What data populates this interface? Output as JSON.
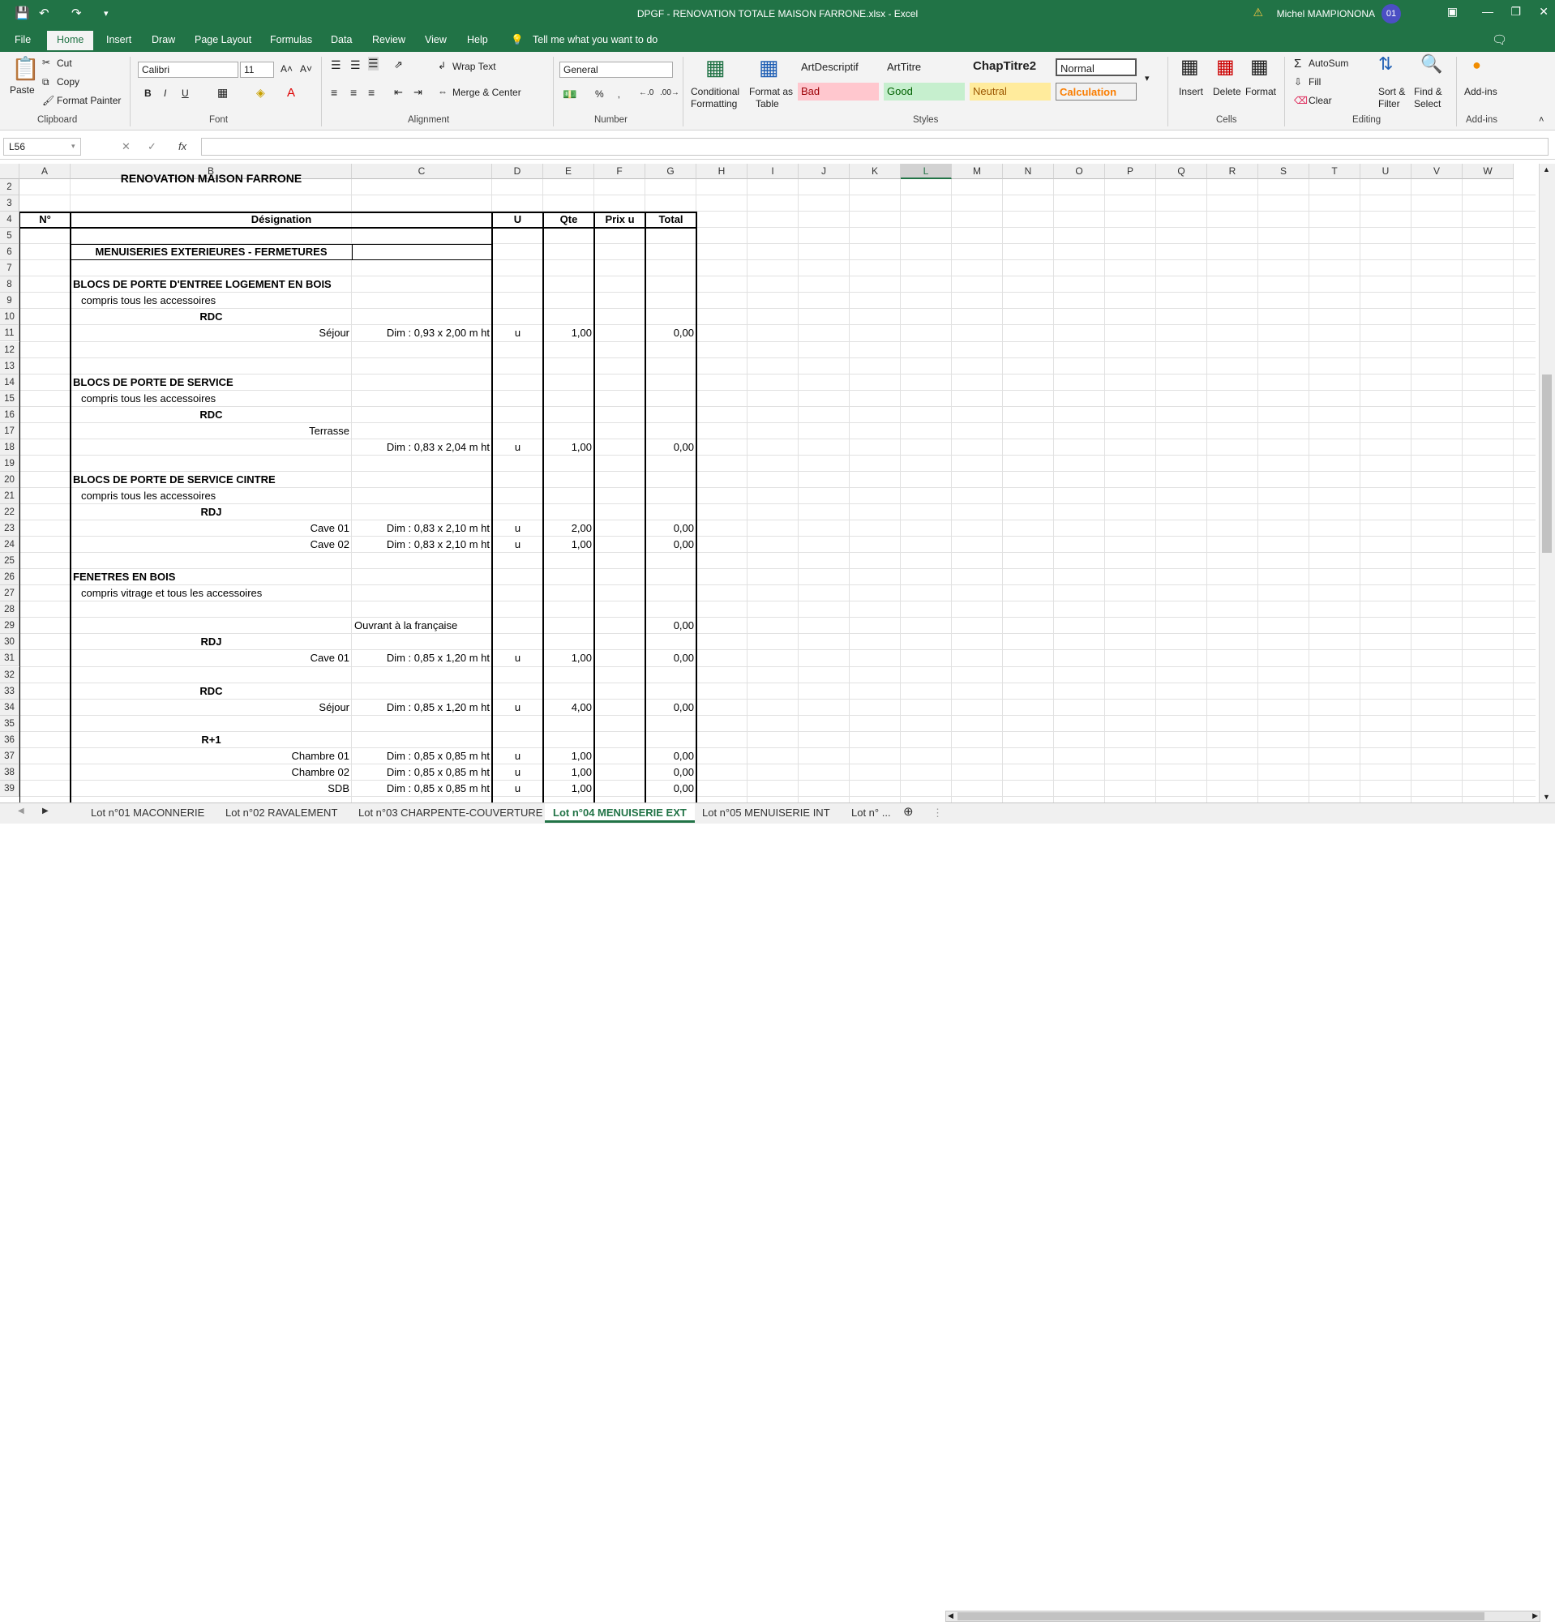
{
  "window": {
    "title": "DPGF - RENOVATION TOTALE MAISON FARRONE.xlsx  -  Excel",
    "user_name": "Michel MAMPIONONA",
    "user_initials": "01"
  },
  "menu_tabs": [
    "File",
    "Home",
    "Insert",
    "Draw",
    "Page Layout",
    "Formulas",
    "Data",
    "Review",
    "View",
    "Help"
  ],
  "tell_me": "Tell me what you want to do",
  "ribbon": {
    "clipboard": {
      "paste": "Paste",
      "cut": "Cut",
      "copy": "Copy",
      "format_painter": "Format Painter",
      "label": "Clipboard"
    },
    "font": {
      "name": "Calibri",
      "size": "11",
      "label": "Font",
      "bold": "B",
      "italic": "I",
      "underline": "U"
    },
    "alignment": {
      "wrap_text": "Wrap Text",
      "merge_center": "Merge & Center",
      "label": "Alignment"
    },
    "number": {
      "format": "General",
      "percent": "%",
      "label": "Number"
    },
    "styles": {
      "conditional": [
        "Conditional",
        "Formatting"
      ],
      "format_table": [
        "Format as",
        "Table"
      ],
      "cells": [
        "ArtDescriptif",
        "ArtTitre",
        "ChapTitre2",
        "Normal",
        "Bad",
        "Good",
        "Neutral",
        "Calculation"
      ],
      "label": "Styles"
    },
    "cells": {
      "insert": "Insert",
      "delete": "Delete",
      "format": "Format",
      "label": "Cells"
    },
    "editing": {
      "autosum": "AutoSum",
      "fill": "Fill",
      "clear": "Clear",
      "sort": [
        "Sort &",
        "Filter"
      ],
      "find": [
        "Find &",
        "Select"
      ],
      "label": "Editing"
    },
    "addins": {
      "button": "Add-ins",
      "label": "Add-ins"
    }
  },
  "formula_bar": {
    "name_box": "L56",
    "fx": "fx",
    "content": ""
  },
  "columns": [
    "A",
    "B",
    "C",
    "D",
    "E",
    "F",
    "G",
    "H",
    "I",
    "J",
    "K",
    "L",
    "M",
    "N",
    "O",
    "P",
    "Q",
    "R",
    "S",
    "T",
    "U",
    "V",
    "W"
  ],
  "rows": [
    "2",
    "3",
    "4",
    "5",
    "6",
    "7",
    "8",
    "9",
    "10",
    "11",
    "12",
    "13",
    "14",
    "15",
    "16",
    "17",
    "18",
    "19",
    "20",
    "21",
    "22",
    "23",
    "24",
    "25",
    "26",
    "27",
    "28",
    "29",
    "30",
    "31",
    "32",
    "33",
    "34",
    "35",
    "36",
    "37",
    "38",
    "39"
  ],
  "sheet": {
    "title_partial": "RENOVATION MAISON  FARRONE",
    "headers": {
      "num": "N°",
      "designation": "Désignation",
      "unit": "U",
      "qty": "Qte",
      "price": "Prix u",
      "total": "Total"
    },
    "cells": [
      {
        "r": 6,
        "c": "B",
        "t": "MENUISERIES EXTERIEURES - FERMETURES",
        "bold": true,
        "align": "center"
      },
      {
        "r": 8,
        "c": "B",
        "t": "BLOCS DE PORTE D'ENTREE LOGEMENT EN BOIS",
        "bold": true,
        "align": "left"
      },
      {
        "r": 9,
        "c": "B",
        "t": "compris tous les accessoires",
        "align": "indent"
      },
      {
        "r": 10,
        "c": "B",
        "t": "RDC",
        "bold": true,
        "align": "center"
      },
      {
        "r": 11,
        "c": "B",
        "t": "Séjour",
        "align": "right"
      },
      {
        "r": 11,
        "c": "C",
        "t": "Dim : 0,93 x 2,00 m ht",
        "align": "right"
      },
      {
        "r": 11,
        "c": "D",
        "t": "u",
        "align": "center"
      },
      {
        "r": 11,
        "c": "E",
        "t": "1,00",
        "align": "right"
      },
      {
        "r": 11,
        "c": "G",
        "t": "0,00",
        "align": "right"
      },
      {
        "r": 14,
        "c": "B",
        "t": "BLOCS DE PORTE DE SERVICE",
        "bold": true,
        "align": "left"
      },
      {
        "r": 15,
        "c": "B",
        "t": "compris tous les accessoires",
        "align": "indent"
      },
      {
        "r": 16,
        "c": "B",
        "t": "RDC",
        "bold": true,
        "align": "center"
      },
      {
        "r": 17,
        "c": "B",
        "t": "Terrasse",
        "align": "right"
      },
      {
        "r": 18,
        "c": "C",
        "t": "Dim : 0,83 x 2,04 m ht",
        "align": "right"
      },
      {
        "r": 18,
        "c": "D",
        "t": "u",
        "align": "center"
      },
      {
        "r": 18,
        "c": "E",
        "t": "1,00",
        "align": "right"
      },
      {
        "r": 18,
        "c": "G",
        "t": "0,00",
        "align": "right"
      },
      {
        "r": 20,
        "c": "B",
        "t": "BLOCS DE PORTE DE SERVICE CINTRE",
        "bold": true,
        "align": "left"
      },
      {
        "r": 21,
        "c": "B",
        "t": "compris tous les accessoires",
        "align": "indent"
      },
      {
        "r": 22,
        "c": "B",
        "t": "RDJ",
        "bold": true,
        "align": "center"
      },
      {
        "r": 23,
        "c": "B",
        "t": "Cave 01",
        "align": "right"
      },
      {
        "r": 23,
        "c": "C",
        "t": "Dim : 0,83 x 2,10 m ht",
        "align": "right"
      },
      {
        "r": 23,
        "c": "D",
        "t": "u",
        "align": "center"
      },
      {
        "r": 23,
        "c": "E",
        "t": "2,00",
        "align": "right"
      },
      {
        "r": 23,
        "c": "G",
        "t": "0,00",
        "align": "right"
      },
      {
        "r": 24,
        "c": "B",
        "t": "Cave 02",
        "align": "right"
      },
      {
        "r": 24,
        "c": "C",
        "t": "Dim : 0,83 x 2,10 m ht",
        "align": "right"
      },
      {
        "r": 24,
        "c": "D",
        "t": "u",
        "align": "center"
      },
      {
        "r": 24,
        "c": "E",
        "t": "1,00",
        "align": "right"
      },
      {
        "r": 24,
        "c": "G",
        "t": "0,00",
        "align": "right"
      },
      {
        "r": 26,
        "c": "B",
        "t": "FENETRES EN BOIS",
        "bold": true,
        "align": "left"
      },
      {
        "r": 27,
        "c": "B",
        "t": "compris vitrage et tous les accessoires",
        "align": "indent"
      },
      {
        "r": 29,
        "c": "C",
        "t": "Ouvrant  à la française",
        "align": "left"
      },
      {
        "r": 29,
        "c": "G",
        "t": "0,00",
        "align": "right"
      },
      {
        "r": 30,
        "c": "B",
        "t": "RDJ",
        "bold": true,
        "align": "center"
      },
      {
        "r": 31,
        "c": "B",
        "t": "Cave 01",
        "align": "right"
      },
      {
        "r": 31,
        "c": "C",
        "t": "Dim : 0,85 x 1,20 m ht",
        "align": "right"
      },
      {
        "r": 31,
        "c": "D",
        "t": "u",
        "align": "center"
      },
      {
        "r": 31,
        "c": "E",
        "t": "1,00",
        "align": "right"
      },
      {
        "r": 31,
        "c": "G",
        "t": "0,00",
        "align": "right"
      },
      {
        "r": 33,
        "c": "B",
        "t": "RDC",
        "bold": true,
        "align": "center"
      },
      {
        "r": 34,
        "c": "B",
        "t": "Séjour",
        "align": "right"
      },
      {
        "r": 34,
        "c": "C",
        "t": "Dim : 0,85 x 1,20 m ht",
        "align": "right"
      },
      {
        "r": 34,
        "c": "D",
        "t": "u",
        "align": "center"
      },
      {
        "r": 34,
        "c": "E",
        "t": "4,00",
        "align": "right"
      },
      {
        "r": 34,
        "c": "G",
        "t": "0,00",
        "align": "right"
      },
      {
        "r": 36,
        "c": "B",
        "t": "R+1",
        "bold": true,
        "align": "center"
      },
      {
        "r": 37,
        "c": "B",
        "t": "Chambre 01",
        "align": "right"
      },
      {
        "r": 37,
        "c": "C",
        "t": "Dim : 0,85 x 0,85 m ht",
        "align": "right"
      },
      {
        "r": 37,
        "c": "D",
        "t": "u",
        "align": "center"
      },
      {
        "r": 37,
        "c": "E",
        "t": "1,00",
        "align": "right"
      },
      {
        "r": 37,
        "c": "G",
        "t": "0,00",
        "align": "right"
      },
      {
        "r": 38,
        "c": "B",
        "t": "Chambre 02",
        "align": "right"
      },
      {
        "r": 38,
        "c": "C",
        "t": "Dim : 0,85 x 0,85 m ht",
        "align": "right"
      },
      {
        "r": 38,
        "c": "D",
        "t": "u",
        "align": "center"
      },
      {
        "r": 38,
        "c": "E",
        "t": "1,00",
        "align": "right"
      },
      {
        "r": 38,
        "c": "G",
        "t": "0,00",
        "align": "right"
      },
      {
        "r": 39,
        "c": "B",
        "t": "SDB",
        "align": "right"
      },
      {
        "r": 39,
        "c": "C",
        "t": "Dim : 0,85 x 0,85 m ht",
        "align": "right"
      },
      {
        "r": 39,
        "c": "D",
        "t": "u",
        "align": "center"
      },
      {
        "r": 39,
        "c": "E",
        "t": "1,00",
        "align": "right"
      },
      {
        "r": 39,
        "c": "G",
        "t": "0,00",
        "align": "right"
      }
    ]
  },
  "sheet_tabs": [
    "Lot n°01 MACONNERIE",
    "Lot n°02 RAVALEMENT",
    "Lot n°03 CHARPENTE-COUVERTURE",
    "Lot n°04 MENUISERIE EXT",
    "Lot n°05 MENUISERIE INT",
    "Lot n° ..."
  ],
  "active_sheet": "Lot n°04 MENUISERIE EXT",
  "colors": {
    "excel_green": "#217346",
    "bad_bg": "#ffc7ce",
    "good_bg": "#c6efce",
    "neutral_bg": "#ffeb9c",
    "calc_text": "#fa7d00"
  }
}
